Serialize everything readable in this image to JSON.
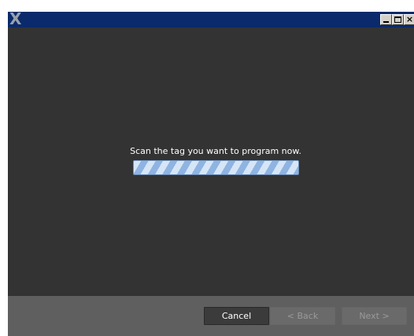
{
  "window": {
    "title_icon": "X",
    "controls": [
      "minimize-icon",
      "maximize-icon",
      "close-icon"
    ]
  },
  "main": {
    "prompt": "Scan the tag you want to program now.",
    "progress": {
      "state": "indeterminate",
      "colors": {
        "light": "#d6e6f7",
        "dark": "#8fb4e2"
      }
    }
  },
  "footer": {
    "cancel_label": "Cancel",
    "back_label": "< Back",
    "next_label": "Next >"
  },
  "colors": {
    "titlebar": "#0a2a6b",
    "content_bg": "#333333",
    "footer_bg": "#5f5f5f"
  }
}
